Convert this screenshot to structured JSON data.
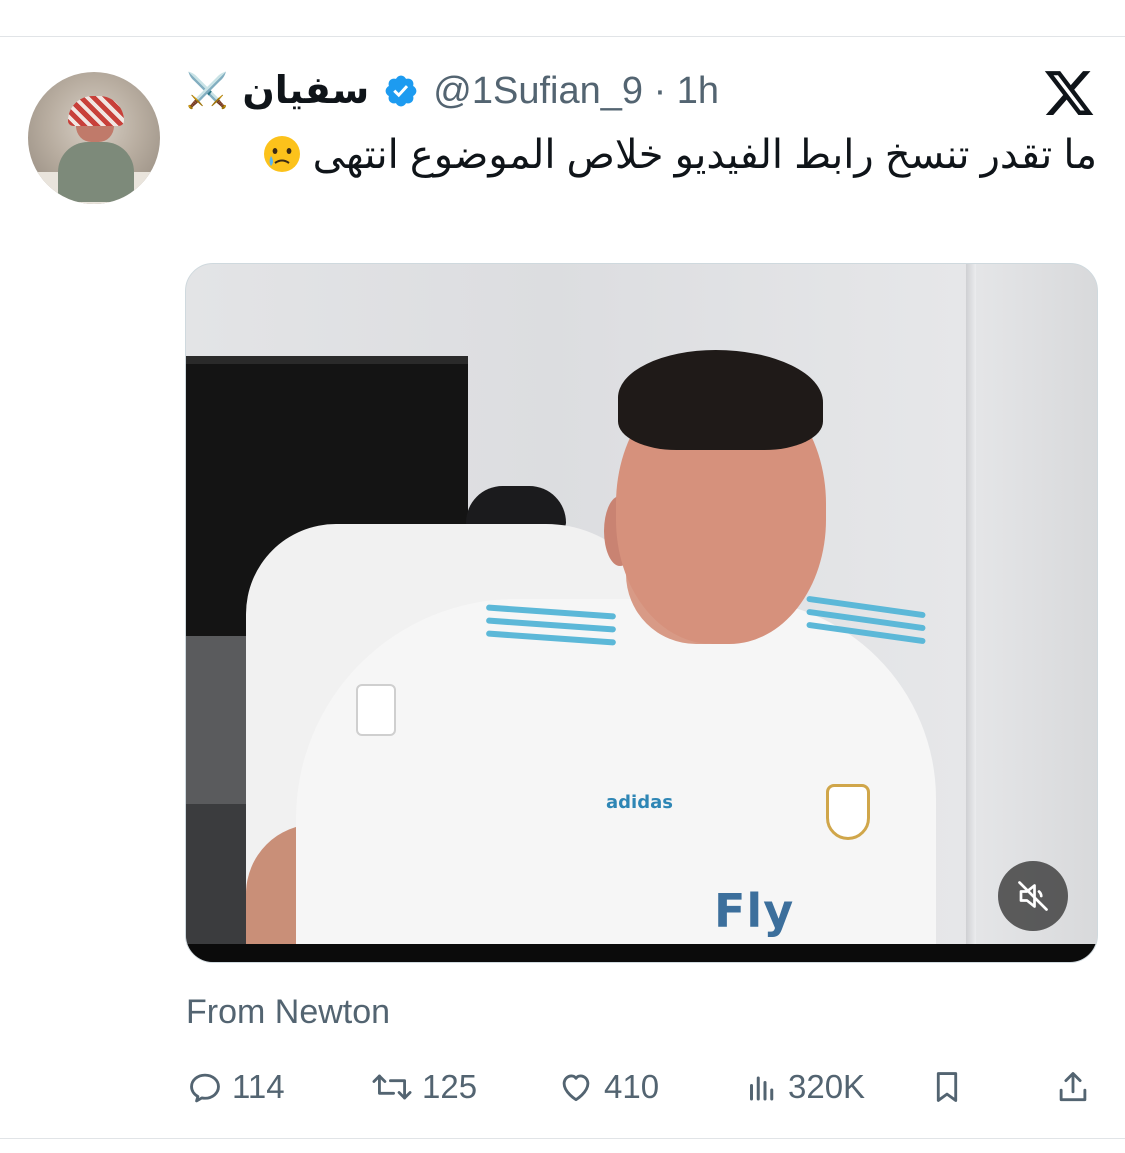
{
  "tweet": {
    "display_name": "سفيان",
    "name_emoji": "⚔️",
    "handle": "@1Sufian_9",
    "separator": "·",
    "time": "1h",
    "text": "ما تقدر تنسخ رابط الفيديو خلاص الموضوع انتهى",
    "text_emoji": "holding-back-tears-emoji",
    "source": "From Newton"
  },
  "media": {
    "type": "video",
    "muted": true,
    "shirt_brand": "adidas",
    "shirt_sponsor": "Fly"
  },
  "actions": {
    "replies": "114",
    "reposts": "125",
    "likes": "410",
    "views": "320K"
  },
  "icons": {
    "app": "x-logo-icon",
    "verified": "verified-badge-icon",
    "mute": "muted-speaker-icon",
    "reply": "reply-icon",
    "repost": "repost-icon",
    "like": "heart-icon",
    "views": "analytics-icon",
    "bookmark": "bookmark-icon",
    "share": "share-icon"
  },
  "colors": {
    "verified": "#1d9bf0",
    "secondary_text": "#536471",
    "primary_text": "#0f1419"
  }
}
